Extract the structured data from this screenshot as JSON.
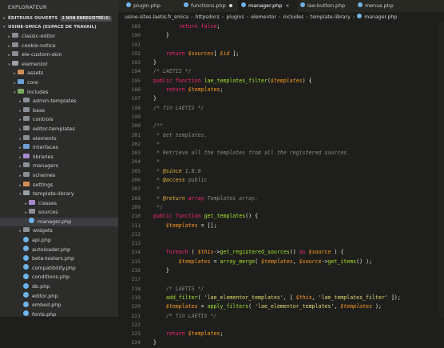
{
  "sidebar": {
    "title": "EXPLORATEUR",
    "open_editors": {
      "label": "ÉDITEURS OUVERTS",
      "badge": "2 NON ENREGISTRÉ(S)"
    },
    "workspace": "USINE-SMICA (ESPACE DE TRAVAIL)",
    "rows": [
      {
        "label": "classic-editor",
        "indent": 2,
        "arrow": "▸",
        "icon": "folder"
      },
      {
        "label": "cookie-notice",
        "indent": 2,
        "arrow": "▸",
        "icon": "folder"
      },
      {
        "label": "ele-custom-skin",
        "indent": 2,
        "arrow": "▸",
        "icon": "folder"
      },
      {
        "label": "elementor",
        "indent": 2,
        "arrow": "▾",
        "icon": "folder open"
      },
      {
        "label": "assets",
        "indent": 3,
        "arrow": "▸",
        "icon": "folder orange"
      },
      {
        "label": "core",
        "indent": 3,
        "arrow": "▸",
        "icon": "folder blue"
      },
      {
        "label": "includes",
        "indent": 3,
        "arrow": "▾",
        "icon": "folder green"
      },
      {
        "label": "admin-templates",
        "indent": 4,
        "arrow": "▸",
        "icon": "folder"
      },
      {
        "label": "base",
        "indent": 4,
        "arrow": "▸",
        "icon": "folder"
      },
      {
        "label": "controls",
        "indent": 4,
        "arrow": "▸",
        "icon": "folder"
      },
      {
        "label": "editor-templates",
        "indent": 4,
        "arrow": "▸",
        "icon": "folder"
      },
      {
        "label": "elements",
        "indent": 4,
        "arrow": "▸",
        "icon": "folder"
      },
      {
        "label": "interfaces",
        "indent": 4,
        "arrow": "▸",
        "icon": "folder blue"
      },
      {
        "label": "libraries",
        "indent": 4,
        "arrow": "▸",
        "icon": "folder purple"
      },
      {
        "label": "managers",
        "indent": 4,
        "arrow": "▸",
        "icon": "folder"
      },
      {
        "label": "schemes",
        "indent": 4,
        "arrow": "▸",
        "icon": "folder"
      },
      {
        "label": "settings",
        "indent": 4,
        "arrow": "▸",
        "icon": "folder orange"
      },
      {
        "label": "template-library",
        "indent": 4,
        "arrow": "▾",
        "icon": "folder open"
      },
      {
        "label": "classes",
        "indent": 5,
        "arrow": "▸",
        "icon": "folder purple"
      },
      {
        "label": "sources",
        "indent": 5,
        "arrow": "▸",
        "icon": "folder"
      },
      {
        "label": "manager.php",
        "indent": 5,
        "arrow": "",
        "icon": "php",
        "selected": true
      },
      {
        "label": "widgets",
        "indent": 4,
        "arrow": "▸",
        "icon": "folder"
      },
      {
        "label": "api.php",
        "indent": 4,
        "arrow": "",
        "icon": "php"
      },
      {
        "label": "autoloader.php",
        "indent": 4,
        "arrow": "",
        "icon": "php"
      },
      {
        "label": "beta-testers.php",
        "indent": 4,
        "arrow": "",
        "icon": "php"
      },
      {
        "label": "compatibility.php",
        "indent": 4,
        "arrow": "",
        "icon": "php"
      },
      {
        "label": "conditions.php",
        "indent": 4,
        "arrow": "",
        "icon": "php"
      },
      {
        "label": "db.php",
        "indent": 4,
        "arrow": "",
        "icon": "php"
      },
      {
        "label": "editor.php",
        "indent": 4,
        "arrow": "",
        "icon": "php"
      },
      {
        "label": "embed.php",
        "indent": 4,
        "arrow": "",
        "icon": "php"
      },
      {
        "label": "fonts.php",
        "indent": 4,
        "arrow": "",
        "icon": "php"
      }
    ]
  },
  "tabs": [
    {
      "label": "plugin.php",
      "active": false,
      "modified": false
    },
    {
      "label": "functions.php",
      "active": false,
      "modified": true
    },
    {
      "label": "manager.php",
      "active": true,
      "modified": false
    },
    {
      "label": "lae-button.php",
      "active": false,
      "modified": false
    },
    {
      "label": "menus.php",
      "active": false,
      "modified": false
    }
  ],
  "breadcrumb": [
    "usine-sites-laetis.fr_smica",
    "httpsdocs",
    "plugins",
    "elementor",
    "includes",
    "template-library",
    "manager.php"
  ],
  "colors": {
    "keyword": "#f92672",
    "function": "#a6e22e",
    "string": "#e6db74",
    "variable": "#fd9720",
    "comment": "#8a8a80",
    "doctag": "#e7b23f"
  },
  "code": [
    {
      "n": "189",
      "tokens": [
        [
          "        ",
          ""
        ],
        [
          "return",
          "kw"
        ],
        [
          " ",
          ""
        ],
        [
          "false",
          "kw"
        ],
        [
          ";",
          ""
        ]
      ]
    },
    {
      "n": "190",
      "tokens": [
        [
          "    }",
          ""
        ]
      ]
    },
    {
      "n": "191",
      "tokens": [
        [
          "",
          ""
        ]
      ]
    },
    {
      "n": "192",
      "tokens": [
        [
          "    ",
          ""
        ],
        [
          "return",
          "kw"
        ],
        [
          " ",
          ""
        ],
        [
          "$sources",
          "var"
        ],
        [
          "[ ",
          ""
        ],
        [
          "$id",
          "var"
        ],
        [
          " ];",
          ""
        ]
      ]
    },
    {
      "n": "193",
      "tokens": [
        [
          "}",
          ""
        ]
      ]
    },
    {
      "n": "194",
      "tokens": [
        [
          "/* LAETIS */",
          "cm"
        ]
      ]
    },
    {
      "n": "195",
      "tokens": [
        [
          "public",
          "kw"
        ],
        [
          " ",
          ""
        ],
        [
          "function",
          "kw"
        ],
        [
          " ",
          ""
        ],
        [
          "lae_templates_filter",
          "fn"
        ],
        [
          "(",
          ""
        ],
        [
          "$templates",
          "var"
        ],
        [
          ") {",
          ""
        ]
      ]
    },
    {
      "n": "196",
      "tokens": [
        [
          "    ",
          ""
        ],
        [
          "return",
          "kw"
        ],
        [
          " ",
          ""
        ],
        [
          "$templates",
          "var"
        ],
        [
          ";",
          ""
        ]
      ]
    },
    {
      "n": "197",
      "tokens": [
        [
          "}",
          ""
        ]
      ]
    },
    {
      "n": "198",
      "tokens": [
        [
          "/* fin LAETIS */",
          "cm"
        ]
      ]
    },
    {
      "n": "199",
      "tokens": [
        [
          "",
          ""
        ]
      ]
    },
    {
      "n": "200",
      "tokens": [
        [
          "/**",
          "cm"
        ]
      ]
    },
    {
      "n": "201",
      "tokens": [
        [
          " * Get templates.",
          "cm"
        ]
      ]
    },
    {
      "n": "202",
      "tokens": [
        [
          " *",
          "cm"
        ]
      ]
    },
    {
      "n": "203",
      "tokens": [
        [
          " * Retrieve all the templates from all the registered sources.",
          "cm"
        ]
      ]
    },
    {
      "n": "204",
      "tokens": [
        [
          " *",
          "cm"
        ]
      ]
    },
    {
      "n": "205",
      "tokens": [
        [
          " * ",
          "cm"
        ],
        [
          "@since",
          "cmtag"
        ],
        [
          " 1.0.0",
          "cm"
        ]
      ]
    },
    {
      "n": "206",
      "tokens": [
        [
          " * ",
          "cm"
        ],
        [
          "@access",
          "cmtag"
        ],
        [
          " public",
          "cm"
        ]
      ]
    },
    {
      "n": "207",
      "tokens": [
        [
          " *",
          "cm"
        ]
      ]
    },
    {
      "n": "208",
      "tokens": [
        [
          " * ",
          "cm"
        ],
        [
          "@return",
          "cmtag"
        ],
        [
          " ",
          "cm"
        ],
        [
          "array",
          "typ"
        ],
        [
          " Templates array.",
          "cm"
        ]
      ]
    },
    {
      "n": "209",
      "tokens": [
        [
          " */",
          "cm"
        ]
      ]
    },
    {
      "n": "210",
      "tokens": [
        [
          "public",
          "kw"
        ],
        [
          " ",
          ""
        ],
        [
          "function",
          "kw"
        ],
        [
          " ",
          ""
        ],
        [
          "get_templates",
          "fn"
        ],
        [
          "() {",
          ""
        ]
      ]
    },
    {
      "n": "211",
      "tokens": [
        [
          "    ",
          ""
        ],
        [
          "$templates",
          "var"
        ],
        [
          " = [];",
          ""
        ]
      ]
    },
    {
      "n": "212",
      "tokens": [
        [
          "",
          ""
        ]
      ]
    },
    {
      "n": "213",
      "tokens": [
        [
          "",
          ""
        ]
      ]
    },
    {
      "n": "214",
      "tokens": [
        [
          "    ",
          ""
        ],
        [
          "foreach",
          "kw"
        ],
        [
          " ( ",
          ""
        ],
        [
          "$this",
          "var"
        ],
        [
          "->",
          ""
        ],
        [
          "get_registered_sources",
          "fn"
        ],
        [
          "() ",
          ""
        ],
        [
          "as",
          "kw"
        ],
        [
          " ",
          ""
        ],
        [
          "$source",
          "var"
        ],
        [
          " ) {",
          ""
        ]
      ]
    },
    {
      "n": "215",
      "tokens": [
        [
          "        ",
          ""
        ],
        [
          "$templates",
          "var"
        ],
        [
          " = ",
          ""
        ],
        [
          "array_merge",
          "fn"
        ],
        [
          "( ",
          ""
        ],
        [
          "$templates",
          "var"
        ],
        [
          ", ",
          ""
        ],
        [
          "$source",
          "var"
        ],
        [
          "->",
          ""
        ],
        [
          "get_items",
          "fn"
        ],
        [
          "() );",
          ""
        ]
      ]
    },
    {
      "n": "216",
      "tokens": [
        [
          "    }",
          ""
        ]
      ]
    },
    {
      "n": "217",
      "tokens": [
        [
          "",
          ""
        ]
      ]
    },
    {
      "n": "218",
      "tokens": [
        [
          "    ",
          ""
        ],
        [
          "/* LAETIS */",
          "cm"
        ]
      ]
    },
    {
      "n": "219",
      "tokens": [
        [
          "    ",
          ""
        ],
        [
          "add_filter",
          "fn"
        ],
        [
          "( ",
          ""
        ],
        [
          "'lae_elementor_templates'",
          "str"
        ],
        [
          ", [ ",
          ""
        ],
        [
          "$this",
          "var"
        ],
        [
          ", ",
          ""
        ],
        [
          "'lae_templates_filter'",
          "str"
        ],
        [
          " ]);",
          ""
        ]
      ]
    },
    {
      "n": "220",
      "tokens": [
        [
          "    ",
          ""
        ],
        [
          "$templates",
          "var"
        ],
        [
          " = ",
          ""
        ],
        [
          "apply_filters",
          "fn"
        ],
        [
          "( ",
          ""
        ],
        [
          "'lae_elementor_templates'",
          "str"
        ],
        [
          ", ",
          ""
        ],
        [
          "$templates",
          "var"
        ],
        [
          " );",
          ""
        ]
      ]
    },
    {
      "n": "221",
      "tokens": [
        [
          "    ",
          ""
        ],
        [
          "/* fin LAETIS */",
          "cm"
        ]
      ]
    },
    {
      "n": "222",
      "tokens": [
        [
          "",
          ""
        ]
      ]
    },
    {
      "n": "223",
      "tokens": [
        [
          "    ",
          ""
        ],
        [
          "return",
          "kw"
        ],
        [
          " ",
          ""
        ],
        [
          "$templates",
          "var"
        ],
        [
          ";",
          ""
        ]
      ]
    },
    {
      "n": "224",
      "tokens": [
        [
          "}",
          ""
        ]
      ]
    }
  ]
}
